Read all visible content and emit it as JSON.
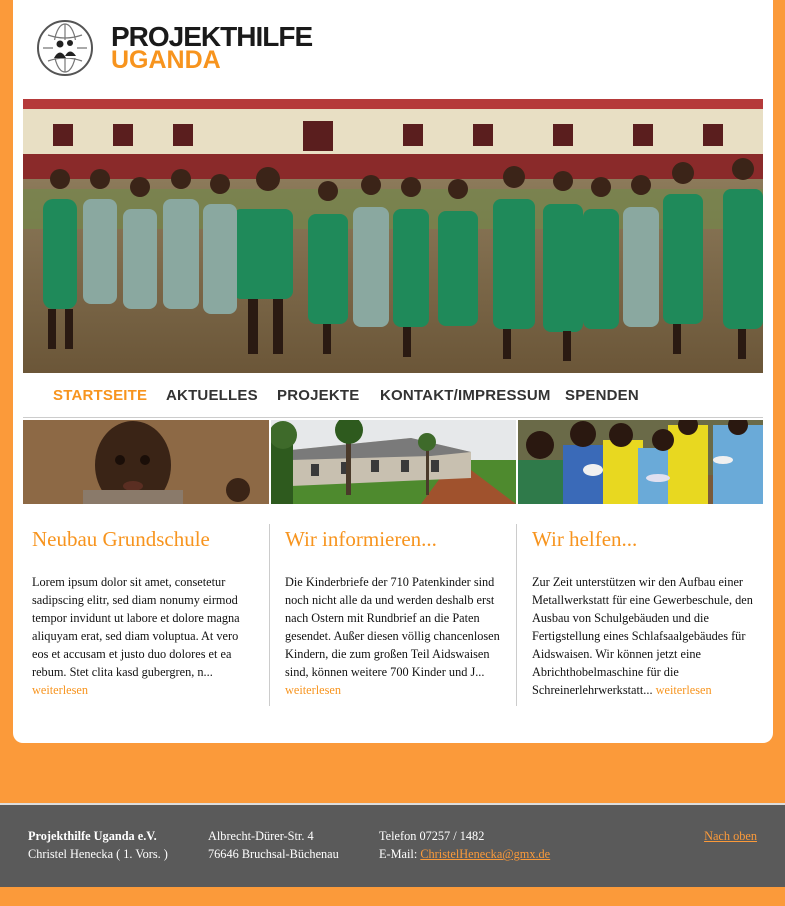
{
  "logo": {
    "line1": "PROJEKTHILFE",
    "line2": "UGANDA"
  },
  "nav": [
    {
      "label": "STARTSEITE",
      "active": true
    },
    {
      "label": "AKTUELLES"
    },
    {
      "label": "PROJEKTE"
    },
    {
      "label": "KONTAKT/IMPRESSUM"
    },
    {
      "label": "SPENDEN"
    }
  ],
  "columns": [
    {
      "title": "Neubau Grundschule",
      "text": "Lorem ipsum dolor sit amet, consetetur sadipscing elitr, sed diam nonumy eirmod tempor invidunt ut labore et dolore magna aliquyam erat, sed diam voluptua. At vero eos et accusam et justo duo dolores et ea rebum. Stet clita kasd gubergren, n...",
      "more": "weiterlesen"
    },
    {
      "title": "Wir informieren...",
      "text": "Die Kinderbriefe der 710 Patenkinder sind noch nicht alle da und werden deshalb erst nach Ostern mit Rundbrief an die Paten gesendet. Außer diesen völlig chancenlosen Kindern, die zum großen Teil Aidswaisen sind, können weitere 700 Kinder und J...",
      "more": "weiterlesen"
    },
    {
      "title": "Wir helfen...",
      "text": "Zur Zeit unterstützen wir den Aufbau einer Metallwerkstatt für eine Gewerbeschule, den Ausbau von Schulgebäuden und die Fertigstellung eines Schlafsaalgebäudes für Aidswaisen. Wir können jetzt eine Abrichthobelmaschine für die Schreinerlehrwerkstatt...",
      "more": "weiterlesen"
    }
  ],
  "footer": {
    "org": "Projekthilfe Uganda e.V.",
    "person": "Christel Henecka ( 1. Vors. )",
    "street": "Albrecht-Dürer-Str. 4",
    "city": "76646 Bruchsal-Büchenau",
    "phone": "Telefon 07257 / 1482",
    "email_label": "E-Mail:",
    "email": "ChristelHenecka@gmx.de",
    "top_link": "Nach oben"
  },
  "colors": {
    "accent": "#f7941e",
    "background": "#fb9a3a",
    "footer": "#5a5a5a"
  }
}
